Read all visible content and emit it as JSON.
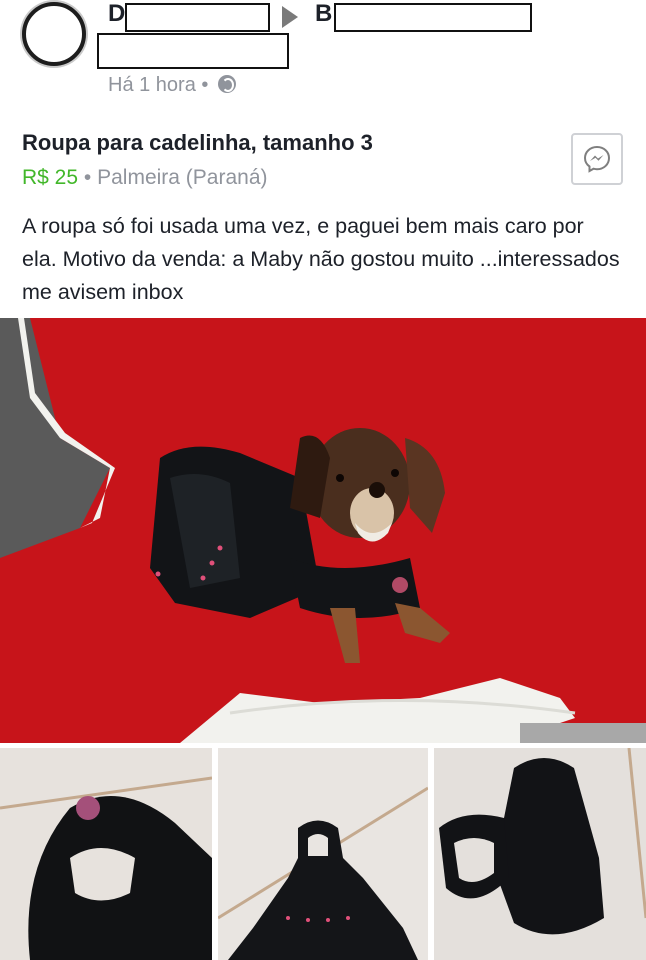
{
  "post": {
    "author_initial": "D",
    "group_initial": "B",
    "time": "Há 1 hora",
    "separator": "•"
  },
  "listing": {
    "title": "Roupa para cadelinha, tamanho 3",
    "price": "R$ 25",
    "location": "Palmeira (Paraná)",
    "description": "A roupa só foi usada uma vez, e paguei bem mais caro por ela. Motivo da venda: a Maby não gostou muito ...interessados me avisem inbox"
  },
  "icons": {
    "privacy": "globe-icon",
    "message": "messenger-icon"
  },
  "colors": {
    "price_green": "#42b72a",
    "meta_gray": "#90949c",
    "blanket_red": "#c7141a"
  }
}
